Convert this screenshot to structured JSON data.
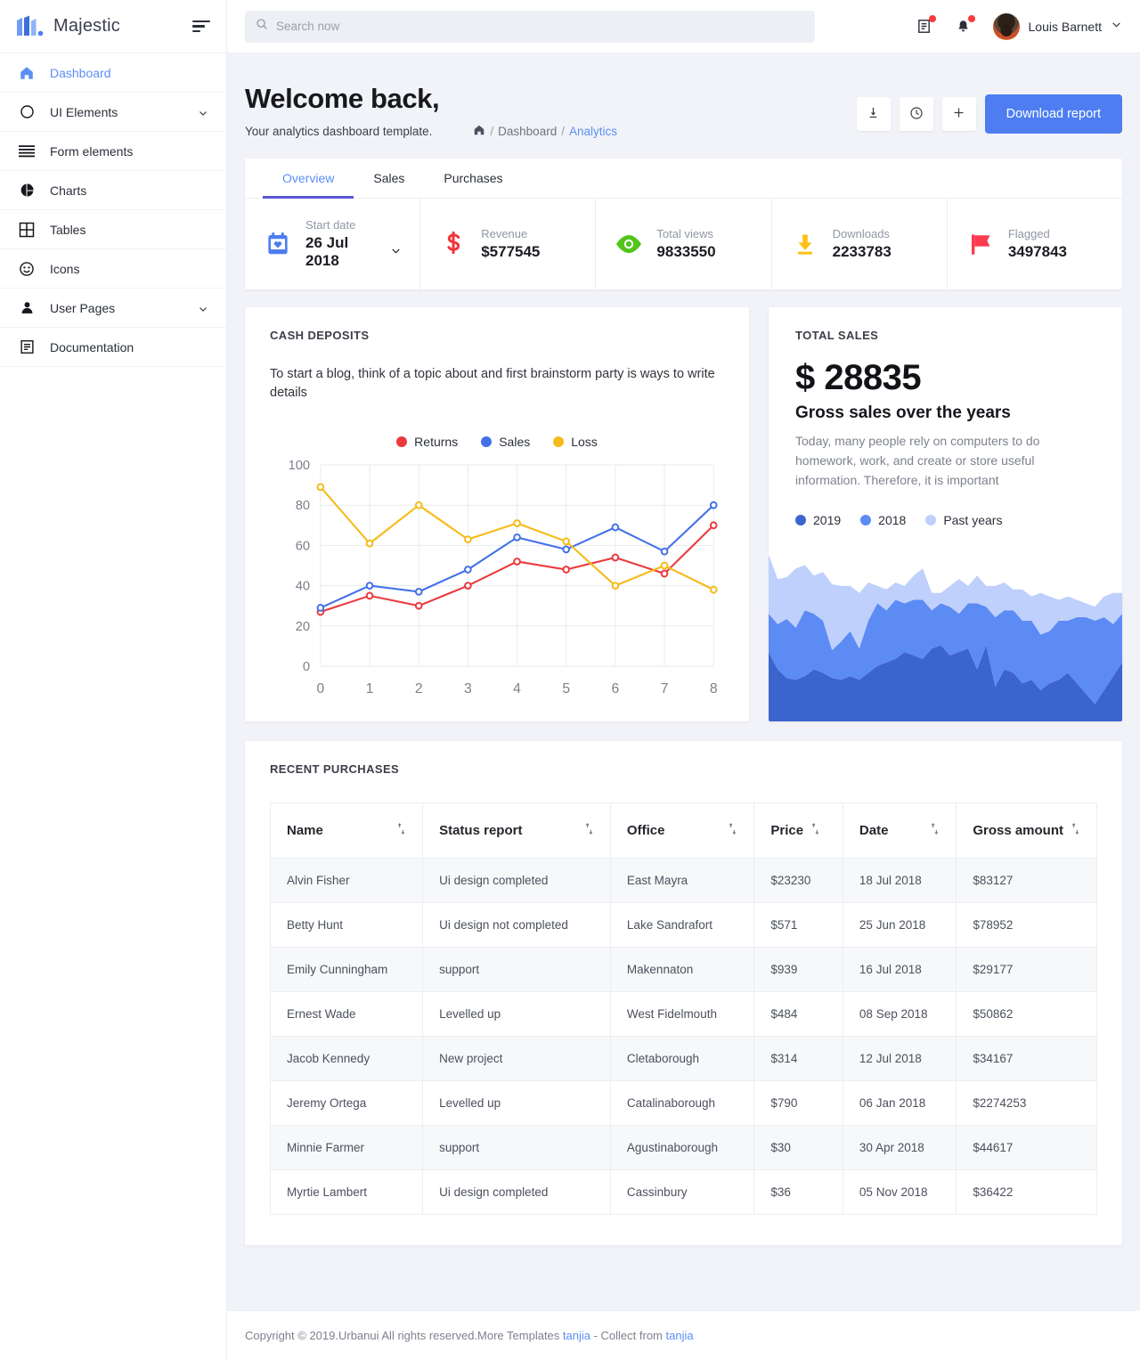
{
  "brand": {
    "name": "Majestic",
    "logo_icon": "majestic-logo-icon",
    "menu_icon": "hamburger-icon"
  },
  "sidebar": {
    "items": [
      {
        "label": "Dashboard",
        "icon": "home-icon",
        "active": true,
        "expandable": false
      },
      {
        "label": "UI Elements",
        "icon": "circle-icon",
        "active": false,
        "expandable": true
      },
      {
        "label": "Form elements",
        "icon": "list-lines-icon",
        "active": false,
        "expandable": false
      },
      {
        "label": "Charts",
        "icon": "pie-chart-icon",
        "active": false,
        "expandable": false
      },
      {
        "label": "Tables",
        "icon": "grid-table-icon",
        "active": false,
        "expandable": false
      },
      {
        "label": "Icons",
        "icon": "smiley-face-icon",
        "active": false,
        "expandable": false
      },
      {
        "label": "User Pages",
        "icon": "person-icon",
        "active": false,
        "expandable": true
      },
      {
        "label": "Documentation",
        "icon": "document-icon",
        "active": false,
        "expandable": false
      }
    ]
  },
  "topbar": {
    "search": {
      "placeholder": "Search now",
      "value": "",
      "icon": "search-icon"
    },
    "messages_icon": "message-icon",
    "notifications_icon": "bell-icon",
    "user": {
      "name": "Louis Barnett",
      "avatar": "user-avatar",
      "caret": "chevron-down-icon"
    }
  },
  "page": {
    "title": "Welcome back,",
    "subtitle": "Your analytics dashboard template.",
    "breadcrumb": {
      "home_icon": "home-icon",
      "items": [
        "Dashboard",
        "Analytics"
      ],
      "separator": "/"
    },
    "actions": {
      "download_icon": "download-icon",
      "history_icon": "clock-icon",
      "add_icon": "plus-icon",
      "primary_label": "Download report"
    }
  },
  "tabs": [
    {
      "label": "Overview",
      "active": true
    },
    {
      "label": "Sales",
      "active": false
    },
    {
      "label": "Purchases",
      "active": false
    }
  ],
  "stats": [
    {
      "icon": "calendar-heart-icon",
      "color": "#4d7df0",
      "label": "Start date",
      "value": "26 Jul 2018",
      "has_caret": true
    },
    {
      "icon": "dollar-icon",
      "color": "#f2353c",
      "label": "Revenue",
      "value": "$577545",
      "has_caret": false
    },
    {
      "icon": "eye-icon",
      "color": "#52c41a",
      "label": "Total views",
      "value": "9833550",
      "has_caret": false
    },
    {
      "icon": "download-arrow-icon",
      "color": "#fcc016",
      "label": "Downloads",
      "value": "2233783",
      "has_caret": false
    },
    {
      "icon": "flag-icon",
      "color": "#fb3a4f",
      "label": "Flagged",
      "value": "3497843",
      "has_caret": false
    }
  ],
  "cash_deposits": {
    "title": "CASH DEPOSITS",
    "description": "To start a blog, think of a topic about and first brainstorm party is ways to write details"
  },
  "total_sales": {
    "title": "TOTAL SALES",
    "amount": "$ 28835",
    "headline": "Gross sales over the years",
    "description": "Today, many people rely on computers to do homework, work, and create or store useful information. Therefore, it is important",
    "legend": [
      {
        "label": "2019",
        "color": "#3b65cc"
      },
      {
        "label": "2018",
        "color": "#5d8bf4"
      },
      {
        "label": "Past years",
        "color": "#bed0fb"
      }
    ]
  },
  "chart_data": [
    {
      "type": "line",
      "title": "CASH DEPOSITS",
      "xlabel": "",
      "ylabel": "",
      "x": [
        0,
        1,
        2,
        3,
        4,
        5,
        6,
        7,
        8
      ],
      "xticks": [
        "0",
        "1",
        "2",
        "3",
        "4",
        "5",
        "6",
        "7",
        "8"
      ],
      "yticks": [
        "0",
        "20",
        "40",
        "60",
        "80",
        "100"
      ],
      "ylim": [
        0,
        100
      ],
      "grid": true,
      "legend_position": "top-center",
      "series": [
        {
          "name": "Returns",
          "color": "#ea3a3d",
          "values": [
            27,
            35,
            30,
            40,
            52,
            48,
            54,
            46,
            70
          ]
        },
        {
          "name": "Sales",
          "color": "#4371e8",
          "values": [
            29,
            40,
            37,
            48,
            64,
            58,
            69,
            57,
            80
          ]
        },
        {
          "name": "Loss",
          "color": "#f5bb18",
          "values": [
            89,
            61,
            80,
            63,
            71,
            62,
            40,
            50,
            38
          ]
        }
      ]
    },
    {
      "type": "area",
      "title": "Gross sales over the years",
      "stacked": true,
      "grid": false,
      "legend_position": "above-chart",
      "ylim": [
        0,
        100
      ],
      "x": [
        0,
        1,
        2,
        3,
        4,
        5,
        6,
        7,
        8,
        9,
        10,
        11,
        12,
        13,
        14,
        15,
        16,
        17,
        18,
        19,
        20,
        21,
        22,
        23,
        24,
        25,
        26,
        27,
        28,
        29,
        30,
        31,
        32,
        33,
        34,
        35,
        36,
        37,
        38,
        39
      ],
      "series": [
        {
          "name": "2019",
          "color": "#3b65cc",
          "values": [
            40,
            30,
            25,
            24,
            26,
            30,
            28,
            25,
            24,
            26,
            24,
            28,
            32,
            34,
            36,
            40,
            38,
            36,
            42,
            44,
            38,
            40,
            42,
            30,
            44,
            20,
            30,
            28,
            22,
            24,
            18,
            22,
            24,
            28,
            22,
            16,
            10,
            18,
            26,
            34
          ]
        },
        {
          "name": "2018",
          "color": "#5d8bf4",
          "values": [
            22,
            26,
            34,
            30,
            38,
            32,
            30,
            16,
            22,
            26,
            18,
            30,
            36,
            30,
            34,
            28,
            32,
            34,
            22,
            24,
            28,
            22,
            26,
            38,
            22,
            40,
            34,
            36,
            36,
            34,
            32,
            30,
            34,
            30,
            38,
            44,
            48,
            42,
            30,
            28
          ]
        },
        {
          "name": "Past years",
          "color": "#bed0fb",
          "values": [
            34,
            26,
            24,
            34,
            26,
            22,
            28,
            38,
            32,
            26,
            32,
            22,
            10,
            12,
            10,
            10,
            14,
            18,
            10,
            6,
            12,
            20,
            10,
            16,
            12,
            18,
            16,
            12,
            18,
            14,
            24,
            20,
            12,
            14,
            10,
            8,
            8,
            12,
            18,
            12
          ]
        }
      ]
    }
  ],
  "recent_purchases": {
    "title": "RECENT PURCHASES",
    "columns": [
      {
        "label": "Name",
        "sortable": true
      },
      {
        "label": "Status report",
        "sortable": true
      },
      {
        "label": "Office",
        "sortable": true
      },
      {
        "label": "Price",
        "sortable": true
      },
      {
        "label": "Date",
        "sortable": true
      },
      {
        "label": "Gross amount",
        "sortable": true
      }
    ],
    "rows": [
      {
        "name": "Alvin Fisher",
        "status": "Ui design completed",
        "office": "East Mayra",
        "price": "$23230",
        "date": "18 Jul 2018",
        "gross": "$83127"
      },
      {
        "name": "Betty Hunt",
        "status": "Ui design not completed",
        "office": "Lake Sandrafort",
        "price": "$571",
        "date": "25 Jun 2018",
        "gross": "$78952"
      },
      {
        "name": "Emily Cunningham",
        "status": "support",
        "office": "Makennaton",
        "price": "$939",
        "date": "16 Jul 2018",
        "gross": "$29177"
      },
      {
        "name": "Ernest Wade",
        "status": "Levelled up",
        "office": "West Fidelmouth",
        "price": "$484",
        "date": "08 Sep 2018",
        "gross": "$50862"
      },
      {
        "name": "Jacob Kennedy",
        "status": "New project",
        "office": "Cletaborough",
        "price": "$314",
        "date": "12 Jul 2018",
        "gross": "$34167"
      },
      {
        "name": "Jeremy Ortega",
        "status": "Levelled up",
        "office": "Catalinaborough",
        "price": "$790",
        "date": "06 Jan 2018",
        "gross": "$2274253"
      },
      {
        "name": "Minnie Farmer",
        "status": "support",
        "office": "Agustinaborough",
        "price": "$30",
        "date": "30 Apr 2018",
        "gross": "$44617"
      },
      {
        "name": "Myrtie Lambert",
        "status": "Ui design completed",
        "office": "Cassinbury",
        "price": "$36",
        "date": "05 Nov 2018",
        "gross": "$36422"
      }
    ]
  },
  "footer": {
    "text_before": "Copyright © 2019.Urbanui All rights reserved.More Templates ",
    "link1": "tanjia",
    "text_mid": " - Collect from ",
    "link2": "tanjia"
  }
}
